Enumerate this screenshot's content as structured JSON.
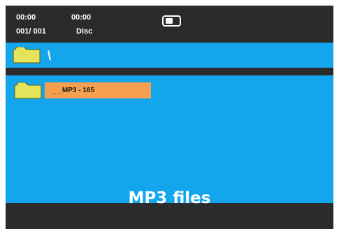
{
  "status": {
    "elapsed_time": "00:00",
    "total_time": "00:00",
    "track_counter": "001/ 001",
    "media_type": "Disc"
  },
  "path_bar": {
    "current_path": "\\",
    "folder_icon": "folder-icon"
  },
  "file_list": {
    "items": [
      {
        "label": "_ _MP3 - 165",
        "icon": "folder-icon",
        "selected": true
      }
    ]
  },
  "caption": "MP3 files",
  "colors": {
    "screen_background": "#2b2b2b",
    "panel_blue": "#13a6ec",
    "selection_orange": "#f6a04f",
    "folder_yellow": "#e4e45a"
  }
}
